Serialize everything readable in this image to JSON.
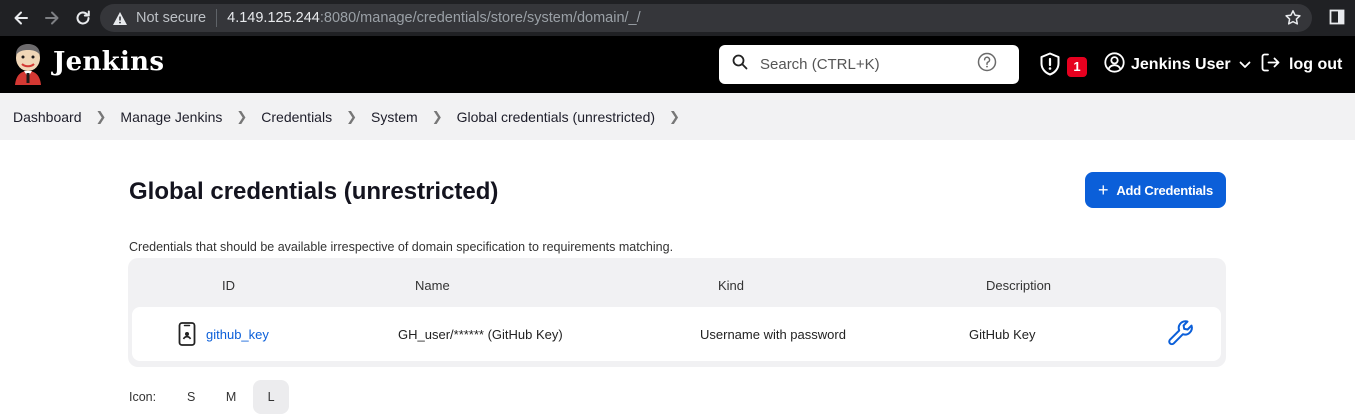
{
  "browser": {
    "not_secure": "Not secure",
    "url_host": "4.149.125.244",
    "url_rest": ":8080/manage/credentials/store/system/domain/_/"
  },
  "header": {
    "brand": "Jenkins",
    "search_placeholder": "Search (CTRL+K)",
    "security_count": "1",
    "user_name": "Jenkins User",
    "logout_label": "log out",
    "badge_color": "#e6001f"
  },
  "breadcrumb": [
    "Dashboard",
    "Manage Jenkins",
    "Credentials",
    "System",
    "Global credentials (unrestricted)"
  ],
  "main": {
    "title": "Global credentials (unrestricted)",
    "add_button": "Add Credentials",
    "description": "Credentials that should be available irrespective of domain specification to requirements matching.",
    "accent": "#0b5fd9"
  },
  "table": {
    "headers": {
      "id": "ID",
      "name": "Name",
      "kind": "Kind",
      "description": "Description"
    },
    "rows": [
      {
        "id": "github_key",
        "name": "GH_user/****** (GitHub Key)",
        "kind": "Username with password",
        "description": "GitHub Key"
      }
    ]
  },
  "icon_size": {
    "label": "Icon:",
    "options": [
      "S",
      "M",
      "L"
    ],
    "selected": "L"
  }
}
